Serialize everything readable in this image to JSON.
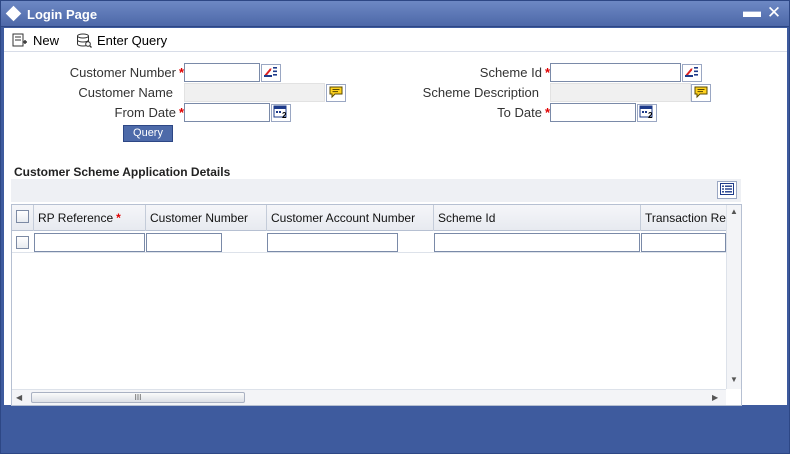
{
  "window": {
    "title": "Login Page",
    "minimize": "▬",
    "close": "✕"
  },
  "toolbar": {
    "new_label": "New",
    "enter_query_label": "Enter Query"
  },
  "form": {
    "customer_number_label": "Customer Number",
    "customer_name_label": "Customer Name",
    "from_date_label": "From Date",
    "scheme_id_label": "Scheme Id",
    "scheme_description_label": "Scheme Description",
    "to_date_label": "To Date",
    "required_marker": "*",
    "query_button": "Query",
    "customer_number_value": "",
    "customer_name_value": "",
    "from_date_value": "",
    "scheme_id_value": "",
    "scheme_description_value": "",
    "to_date_value": ""
  },
  "section": {
    "title": "Customer Scheme Application Details"
  },
  "grid": {
    "columns": [
      "RP Reference",
      "Customer Number",
      "Customer Account Number",
      "Scheme Id",
      "Transaction Re"
    ],
    "scroll_thumb_grip": "III",
    "left_arrow": "◀",
    "right_arrow": "▶",
    "up_arrow": "▲",
    "down_arrow": "▼"
  },
  "colors": {
    "titlebar": "#4d68a8",
    "frame": "#3e5b9e",
    "required": "#e00000"
  },
  "icons": {
    "title": "diamond-icon",
    "new": "new-record-icon",
    "enter_query": "database-query-icon",
    "lov": "list-of-values-icon",
    "description": "speech-bubble-icon",
    "calendar": "calendar-icon",
    "grid_view": "list-view-icon"
  }
}
